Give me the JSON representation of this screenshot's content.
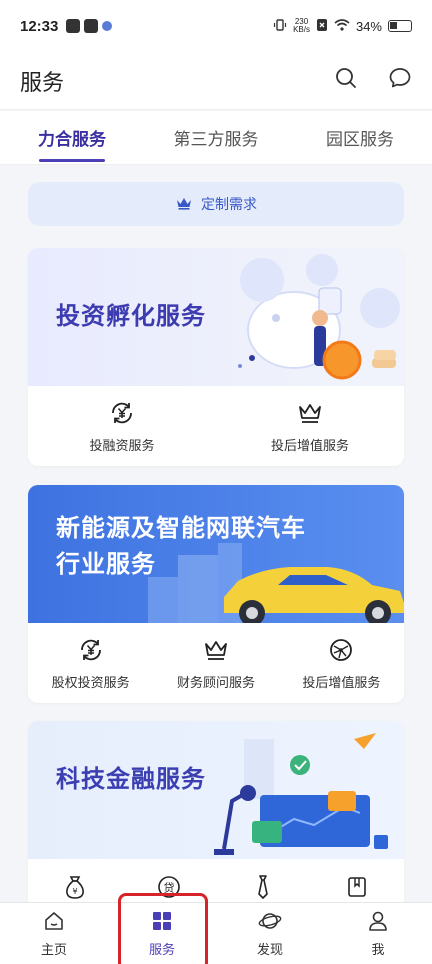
{
  "status_bar": {
    "time": "12:33",
    "speed_top": "230",
    "speed_bottom": "KB/s",
    "battery": "34%"
  },
  "header": {
    "title": "服务",
    "search_icon": "search-icon",
    "message_icon": "message-icon"
  },
  "tabs": [
    {
      "label": "力合服务",
      "active": true
    },
    {
      "label": "第三方服务",
      "active": false
    },
    {
      "label": "园区服务",
      "active": false
    }
  ],
  "custom_request": {
    "label": "定制需求",
    "icon": "crown-icon"
  },
  "cards": [
    {
      "title": "投资孵化服务",
      "actions": [
        {
          "label": "投融资服务",
          "icon": "yen-exchange-icon"
        },
        {
          "label": "投后增值服务",
          "icon": "crown-icon"
        }
      ]
    },
    {
      "title": "新能源及智能网联汽车行业服务",
      "actions": [
        {
          "label": "股权投资服务",
          "icon": "yen-exchange-icon"
        },
        {
          "label": "财务顾问服务",
          "icon": "crown-icon"
        },
        {
          "label": "投后增值服务",
          "icon": "network-globe-icon"
        }
      ]
    },
    {
      "title": "科技金融服务",
      "actions": [
        {
          "label": "",
          "icon": "money-bag-icon"
        },
        {
          "label": "",
          "icon": "loan-icon"
        },
        {
          "label": "",
          "icon": "tie-icon"
        },
        {
          "label": "",
          "icon": "bookmark-icon"
        }
      ]
    }
  ],
  "bottom_nav": [
    {
      "label": "主页",
      "icon": "home-icon",
      "active": false
    },
    {
      "label": "服务",
      "icon": "grid-icon",
      "active": true
    },
    {
      "label": "发现",
      "icon": "planet-icon",
      "active": false
    },
    {
      "label": "我",
      "icon": "user-icon",
      "active": false
    }
  ],
  "colors": {
    "accent": "#4b3fb8",
    "highlight": "#d6232a",
    "custom_btn_bg": "#e4ecfb"
  }
}
